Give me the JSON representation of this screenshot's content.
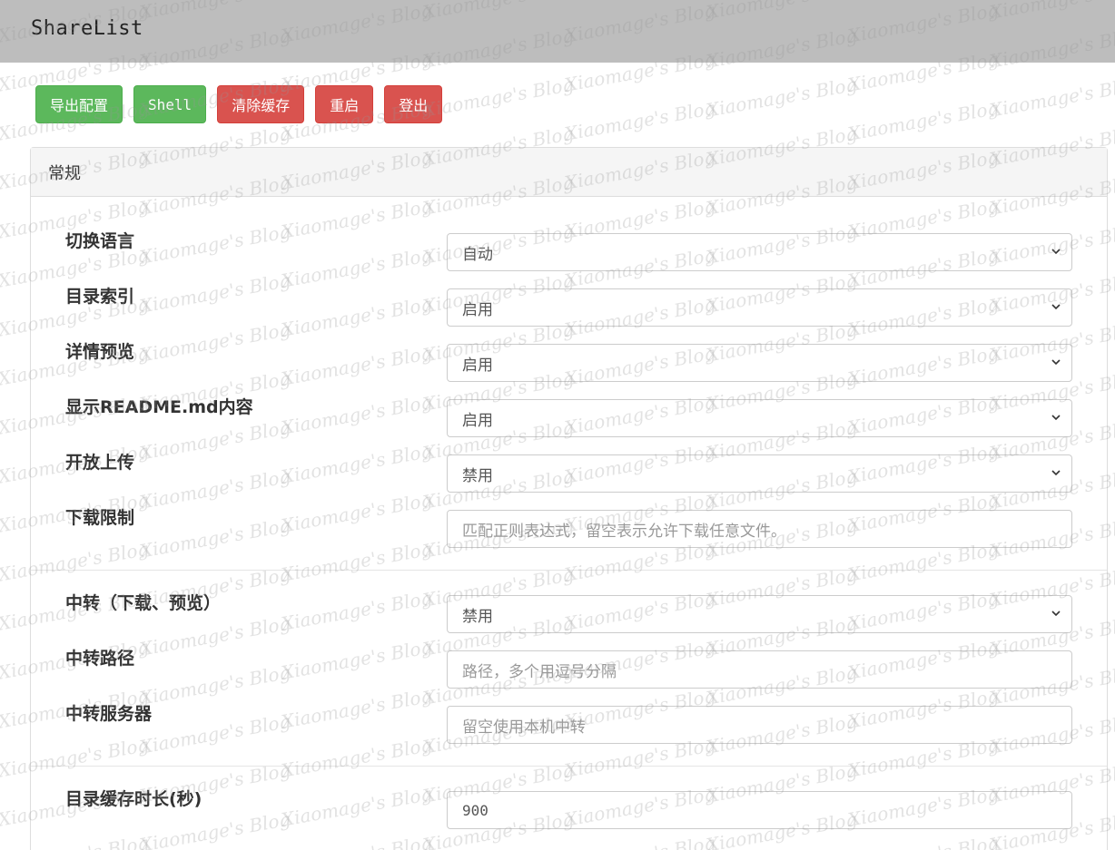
{
  "app": {
    "title": "ShareList"
  },
  "toolbar": {
    "export_label": "导出配置",
    "shell_label": "Shell",
    "clear_cache_label": "清除缓存",
    "restart_label": "重启",
    "logout_label": "登出"
  },
  "panel": {
    "title": "常规",
    "fields": {
      "language": {
        "label": "切换语言",
        "value": "自动"
      },
      "dir_index": {
        "label": "目录索引",
        "value": "启用"
      },
      "detail_preview": {
        "label": "详情预览",
        "value": "启用"
      },
      "show_readme": {
        "label": "显示README.md内容",
        "value": "启用"
      },
      "open_upload": {
        "label": "开放上传",
        "value": "禁用"
      },
      "download_limit": {
        "label": "下载限制",
        "placeholder": "匹配正则表达式，留空表示允许下载任意文件。"
      },
      "proxy": {
        "label": "中转（下载、预览）",
        "value": "禁用"
      },
      "proxy_paths": {
        "label": "中转路径",
        "placeholder": "路径，多个用逗号分隔"
      },
      "proxy_server": {
        "label": "中转服务器",
        "placeholder": "留空使用本机中转"
      },
      "dir_cache_ttl": {
        "label": "目录缓存时长(秒)",
        "value": "900"
      }
    }
  },
  "watermark": {
    "text": "Xiaomage's Blog"
  },
  "colors": {
    "topbar": "#bdbdbd",
    "success": "#5cb85c",
    "danger": "#d9534f"
  },
  "icons": {
    "select_arrow": "chevron-down-icon"
  }
}
